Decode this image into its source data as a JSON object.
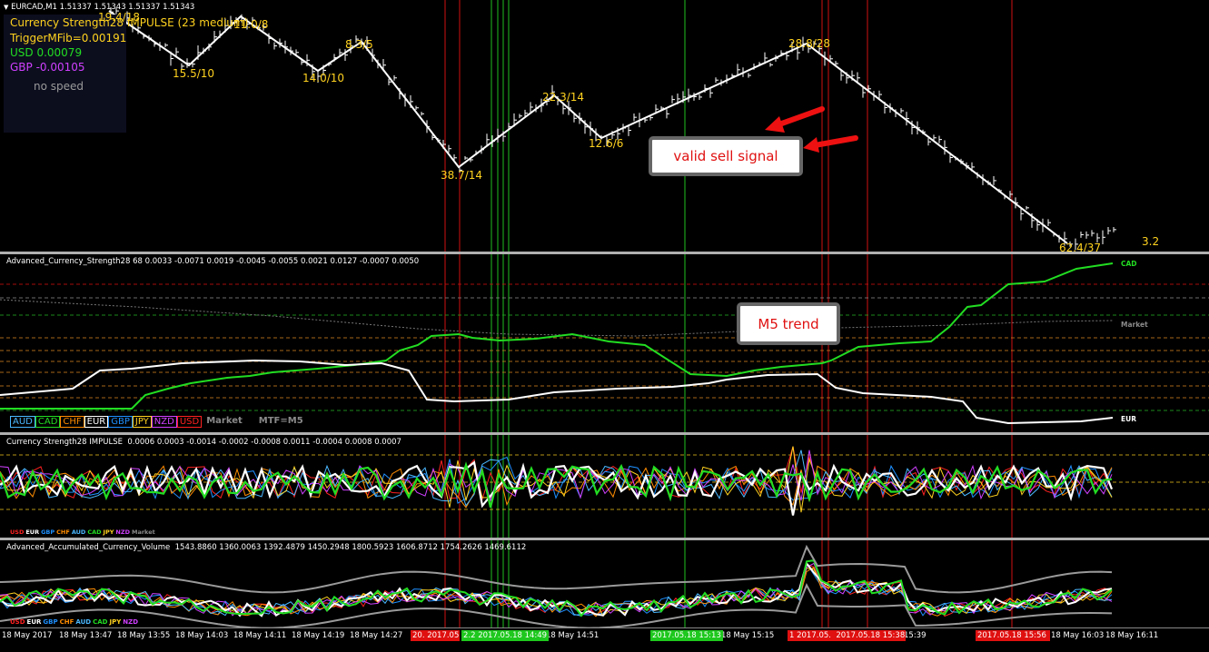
{
  "colors": {
    "usd": "#ff2020",
    "eur": "#ffffff",
    "gbp": "#1e90ff",
    "chf": "#ff8c00",
    "aud": "#4ab8ff",
    "cad": "#22dd22",
    "jpy": "#ffd21f",
    "nzd": "#d040ff",
    "market": "#8a8a8a"
  },
  "main": {
    "symbol": "EURCAD,M1  1.51337 1.51343 1.51337 1.51343",
    "info": {
      "line1": "Currency Strength28 IMPULSE (23 medium)",
      "line2": "TriggerMFib=0.00191",
      "line3": "USD 0.00079",
      "line4": "GBP -0.00105",
      "line5": "no speed"
    },
    "zigzag_labels": [
      "19.4/18",
      "15.5/10",
      "11.0/8",
      "14.0/10",
      "8.3/5",
      "38.7/14",
      "22.3/14",
      "12.6/6",
      "28.8/28",
      "62.4/37",
      "3.2"
    ]
  },
  "callouts": {
    "sell": "valid sell signal",
    "trend": "M5 trend"
  },
  "acs": {
    "title": "Advanced_Currency_Strength28 68 0.0033 -0.0071 0.0019 -0.0045 -0.0055 0.0021 0.0127 -0.0007 0.0050",
    "right_labels": {
      "cad": "CAD",
      "market": "Market",
      "eur": "EUR"
    },
    "legend": [
      "AUD",
      "CAD",
      "CHF",
      "EUR",
      "GBP",
      "JPY",
      "NZD",
      "USD"
    ],
    "legend_extra": "Market",
    "tf": "MTF=M5"
  },
  "impulse": {
    "title": "Currency Strength28 IMPULSE  0.0006 0.0003 -0.0014 -0.0002 -0.0008 0.0011 -0.0004 0.0008 0.0007",
    "legend": [
      "USD",
      "EUR",
      "GBP",
      "CHF",
      "AUD",
      "CAD",
      "JPY",
      "NZD",
      "Market"
    ]
  },
  "volume": {
    "title": "Advanced_Accumulated_Currency_Volume  1543.8860 1360.0063 1392.4879 1450.2948 1800.5923 1606.8712 1754.2626 1469.6112",
    "legend": [
      "USD",
      "EUR",
      "GBP",
      "CHF",
      "AUD",
      "CAD",
      "JPY",
      "NZD"
    ]
  },
  "time_axis": {
    "ticks": [
      "18 May 2017",
      "18 May 13:47",
      "18 May 13:55",
      "18 May 14:03",
      "18 May 14:11",
      "18 May 14:19",
      "18 May 14:27",
      "18 May 14:51",
      "18 May 15:15",
      "15:39",
      "18 May 16:03",
      "18 May 16:11"
    ],
    "sessions": [
      "20. 2017.05",
      "2.2 2017.05.18 14:49",
      "2017.05.18 15:13",
      "1 2017.05.  2017.05.18 15:38",
      "2017.05.18 15:56"
    ]
  }
}
